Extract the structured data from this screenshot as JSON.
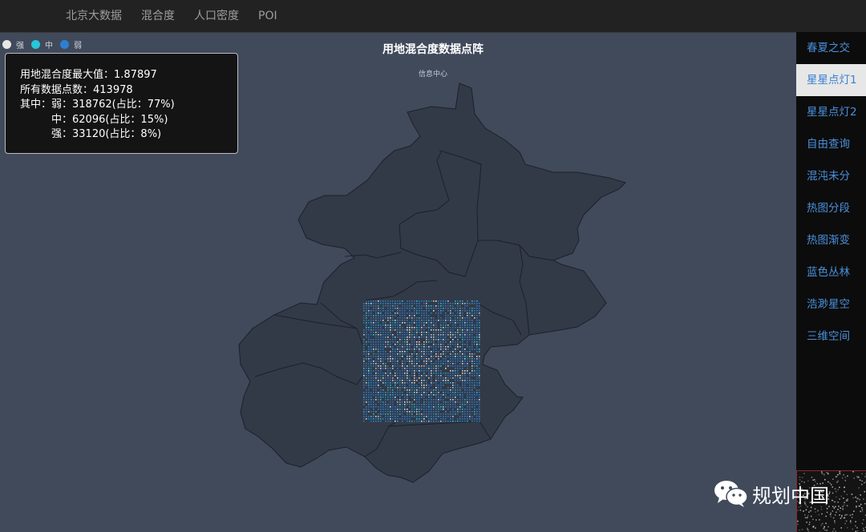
{
  "nav": {
    "items": [
      "北京大数据",
      "混合度",
      "人口密度",
      "POI"
    ]
  },
  "legend": [
    {
      "label": "强",
      "color": "#e6e6e6"
    },
    {
      "label": "中",
      "color": "#27c6d8"
    },
    {
      "label": "弱",
      "color": "#2e7fd2"
    }
  ],
  "info": {
    "max_line": "用地混合度最大值：1.87897",
    "count_line": "所有数据点数：413978",
    "weak_line": "其中：弱：318762(占比：77%)",
    "mid_line": "中：62096(占比：15%)",
    "strong_line": "强：33120(占比：8%)"
  },
  "map": {
    "title": "用地混合度数据点阵",
    "subtitle": "信息中心",
    "region_fill": "#323a47",
    "border_color": "#1c212a"
  },
  "sidebar": {
    "items": [
      {
        "label": "春夏之交",
        "active": false
      },
      {
        "label": "星星点灯1",
        "active": true
      },
      {
        "label": "星星点灯2",
        "active": false
      },
      {
        "label": "自由查询",
        "active": false
      },
      {
        "label": "混沌未分",
        "active": false
      },
      {
        "label": "热图分段",
        "active": false
      },
      {
        "label": "热图渐变",
        "active": false
      },
      {
        "label": "蓝色丛林",
        "active": false
      },
      {
        "label": "浩渺星空",
        "active": false
      },
      {
        "label": "三维空间",
        "active": false
      }
    ]
  },
  "watermark": {
    "text": "规划中国",
    "icon": "wechat-icon"
  }
}
